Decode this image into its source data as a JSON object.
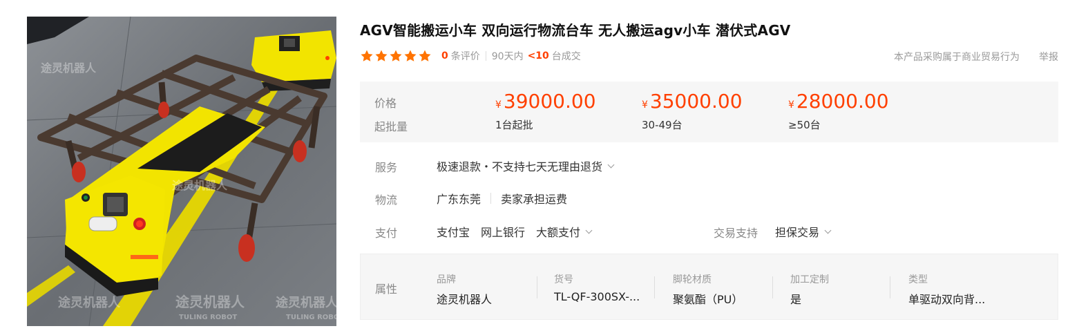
{
  "product": {
    "title": "AGV智能搬运小车 双向运行物流台车 无人搬运agv小车 潜伏式AGV",
    "image_watermark": "途灵机器人",
    "image_watermark_en": "TULING ROBOT"
  },
  "rating": {
    "stars": 5,
    "review_count": "0",
    "review_suffix": "条评价",
    "period": "90天内",
    "deals_count": "<10",
    "deals_suffix": "台成交"
  },
  "links": {
    "business_notice": "本产品采购属于商业贸易行为",
    "report": "举报"
  },
  "pricing": {
    "price_label": "价格",
    "min_order_label": "起批量",
    "currency_symbol": "¥",
    "tiers": [
      {
        "price": "39000.00",
        "quantity": "1台起批"
      },
      {
        "price": "35000.00",
        "quantity": "30-49台"
      },
      {
        "price": "28000.00",
        "quantity": "≥50台"
      }
    ]
  },
  "service": {
    "label": "服务",
    "value": "极速退款・不支持七天无理由退货"
  },
  "logistics": {
    "label": "物流",
    "origin": "广东东莞",
    "shipping": "卖家承担运费"
  },
  "payment": {
    "label": "支付",
    "methods": [
      "支付宝",
      "网上银行",
      "大额支付"
    ],
    "trade_support_label": "交易支持",
    "trade_support_value": "担保交易"
  },
  "attributes": {
    "label": "属性",
    "items": [
      {
        "name": "品牌",
        "value": "途灵机器人"
      },
      {
        "name": "货号",
        "value": "TL-QF-300SX-..."
      },
      {
        "name": "脚轮材质",
        "value": "聚氨酯（PU）"
      },
      {
        "name": "加工定制",
        "value": "是"
      },
      {
        "name": "类型",
        "value": "单驱动双向背..."
      }
    ]
  },
  "colors": {
    "accent": "#ff4000",
    "star": "#ff7300",
    "panel_bg": "#f6f6f6",
    "agv_yellow": "#f2e400"
  }
}
